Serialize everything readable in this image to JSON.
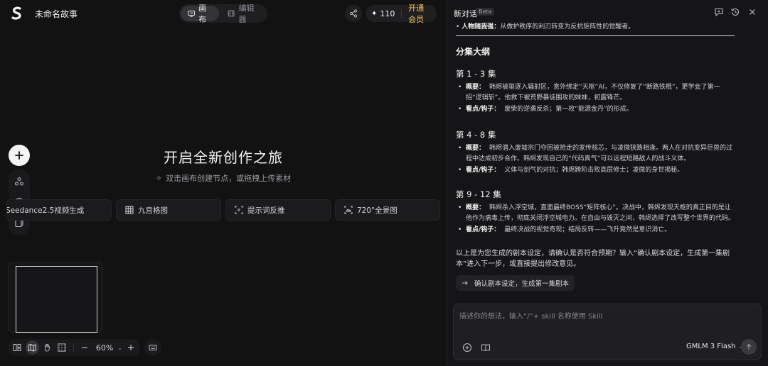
{
  "app": {
    "project_title": "未命名故事"
  },
  "mode_tabs": [
    {
      "label": "画布",
      "icon": "canvas-icon",
      "active": true
    },
    {
      "label": "编辑器",
      "icon": "editor-icon",
      "active": false
    }
  ],
  "credits": {
    "count": "110",
    "upgrade_label": "开通会员"
  },
  "hero": {
    "title": "开启全新创作之旅",
    "subtitle": "双击画布创建节点，或拖拽上传素材"
  },
  "quick_actions": [
    {
      "label": "Seedance2.5视频生成",
      "icon": "video-icon"
    },
    {
      "label": "九宫格图",
      "icon": "grid-icon"
    },
    {
      "label": "提示词反推",
      "icon": "prompt-icon"
    },
    {
      "label": "720°全景图",
      "icon": "panorama-icon"
    }
  ],
  "zoom": {
    "level": "60%"
  },
  "chat": {
    "title": "新对话",
    "badge": "Beta",
    "cut_line": {
      "label": "人物随我强：",
      "text": "从做护秩序的利刃转变为反抗矩阵性的觉醒者。"
    },
    "heading": "分集大纲",
    "episodes": [
      {
        "title": "第 1 - 3 集",
        "bullets": [
          {
            "label": "概要：",
            "text": "韩烬被驱逐入辐射区，意外绑定“天枢”AI，不仅修复了“断路铁棍”，更学会了第一招“逻辑斩”。他救下被荒野暴徒围攻的妹妹，初露锋芒。"
          },
          {
            "label": "看点/钩子：",
            "text": "废柴的逆袭反杀；第一枚“能源金丹”的形成。"
          }
        ]
      },
      {
        "title": "第 4 - 8 集",
        "bullets": [
          {
            "label": "概要：",
            "text": "韩烬潜入废墟宗门夺回被抢走的家传核芯，与凌微狭路相逢。两人在对抗变异巨兽的过程中达成初步合作。韩烬发现自己的“代码真气”可以远程短路敌人的战斗义体。"
          },
          {
            "label": "看点/钩子：",
            "text": "义体与剑气的对抗；韩烬跨阶击败高层修士；凌微的身世揭秘。"
          }
        ]
      },
      {
        "title": "第 9 - 12 集",
        "bullets": [
          {
            "label": "概要：",
            "text": "韩烬杀入浮空城，直面最终BOSS“矩阵核心”。决战中，韩烬发现天枢的真正目的是让他作为病毒上传，彻底关闭浮空城电力。在自由与毁灭之间，韩烬选择了改写整个世界的代码。"
          },
          {
            "label": "看点/钩子：",
            "text": "最终决战的视觉奇观；结局反转——飞升竟然是意识消亡。"
          }
        ]
      }
    ],
    "closing": "以上是为您生成的剧本设定，请确认是否符合预期？输入“确认剧本设定，生成第一集剧本”进入下一步，或直接提出修改意见。",
    "suggestion": "确认剧本设定，生成第一集剧本",
    "input_placeholder": "描述你的想法，输入“/”+ skill 名称使用 Skill",
    "model": "GMLM 3 Flash"
  }
}
